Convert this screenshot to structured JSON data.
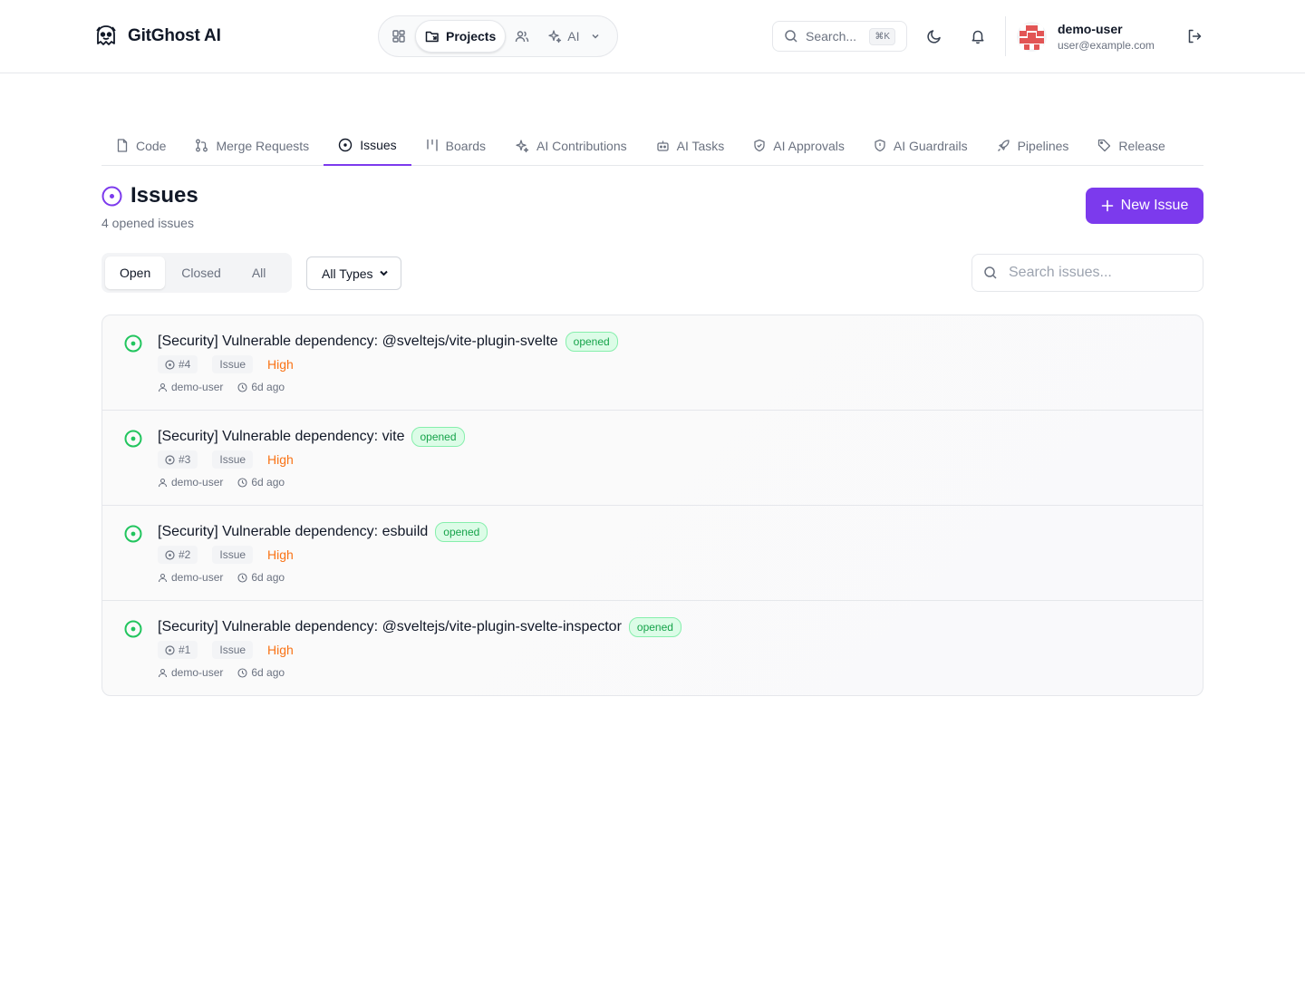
{
  "app": {
    "name": "GitGhost AI"
  },
  "topnav": {
    "items": [
      {
        "label": "",
        "icon": "dashboard-grid-icon"
      },
      {
        "label": "Projects",
        "icon": "folder-icon",
        "active": true
      },
      {
        "label": "",
        "icon": "users-icon"
      },
      {
        "label": "AI",
        "icon": "sparkles-icon"
      }
    ]
  },
  "search": {
    "placeholder": "Search...",
    "shortcut": "⌘K"
  },
  "user": {
    "name": "demo-user",
    "email": "user@example.com"
  },
  "project_tabs": [
    {
      "label": "Code",
      "icon": "file-icon"
    },
    {
      "label": "Merge Requests",
      "icon": "git-pull-request-icon"
    },
    {
      "label": "Issues",
      "icon": "circle-dot-icon",
      "active": true
    },
    {
      "label": "Boards",
      "icon": "kanban-icon"
    },
    {
      "label": "AI Contributions",
      "icon": "sparkles-icon"
    },
    {
      "label": "AI Tasks",
      "icon": "bot-icon"
    },
    {
      "label": "AI Approvals",
      "icon": "shield-check-icon"
    },
    {
      "label": "AI Guardrails",
      "icon": "shield-alert-icon"
    },
    {
      "label": "Pipelines",
      "icon": "rocket-icon"
    },
    {
      "label": "Release",
      "icon": "tag-icon"
    }
  ],
  "page": {
    "title": "Issues",
    "subtitle": "4 opened issues",
    "new_button": "New Issue"
  },
  "filters": {
    "state_options": [
      "Open",
      "Closed",
      "All"
    ],
    "state_selected": "Open",
    "type_selected": "All Types",
    "search_placeholder": "Search issues..."
  },
  "colors": {
    "accent": "#7c3aed",
    "open_status": "#22c55e",
    "priority_high": "#f97316"
  },
  "issues": [
    {
      "title": "[Security] Vulnerable dependency: @sveltejs/vite-plugin-svelte",
      "state": "opened",
      "number": "#4",
      "type": "Issue",
      "priority": "High",
      "author": "demo-user",
      "time": "6d ago"
    },
    {
      "title": "[Security] Vulnerable dependency: vite",
      "state": "opened",
      "number": "#3",
      "type": "Issue",
      "priority": "High",
      "author": "demo-user",
      "time": "6d ago"
    },
    {
      "title": "[Security] Vulnerable dependency: esbuild",
      "state": "opened",
      "number": "#2",
      "type": "Issue",
      "priority": "High",
      "author": "demo-user",
      "time": "6d ago"
    },
    {
      "title": "[Security] Vulnerable dependency: @sveltejs/vite-plugin-svelte-inspector",
      "state": "opened",
      "number": "#1",
      "type": "Issue",
      "priority": "High",
      "author": "demo-user",
      "time": "6d ago"
    }
  ]
}
